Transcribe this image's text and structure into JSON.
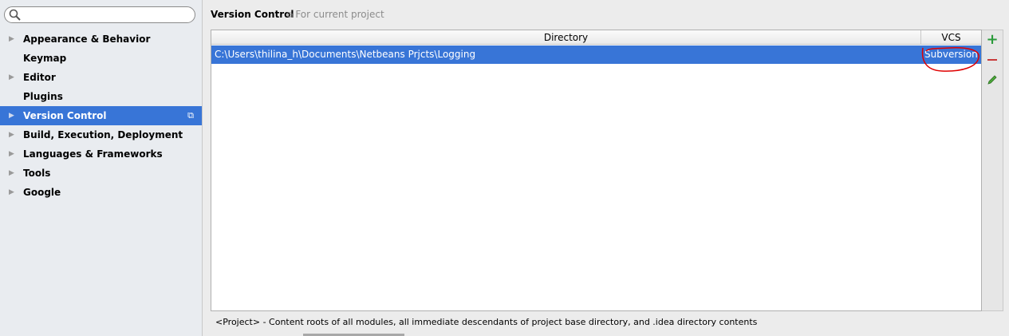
{
  "sidebar": {
    "search_placeholder": "",
    "items": [
      {
        "label": "Appearance & Behavior",
        "expandable": true
      },
      {
        "label": "Keymap",
        "expandable": false
      },
      {
        "label": "Editor",
        "expandable": true
      },
      {
        "label": "Plugins",
        "expandable": false
      },
      {
        "label": "Version Control",
        "expandable": true,
        "selected": true
      },
      {
        "label": "Build, Execution, Deployment",
        "expandable": true
      },
      {
        "label": "Languages & Frameworks",
        "expandable": true
      },
      {
        "label": "Tools",
        "expandable": true
      },
      {
        "label": "Google",
        "expandable": true
      }
    ]
  },
  "header": {
    "title": "Version Control",
    "scope": "For current project"
  },
  "table": {
    "columns": [
      "Directory",
      "VCS"
    ],
    "rows": [
      {
        "directory": "C:\\Users\\thilina_h\\Documents\\Netbeans Prjcts\\Logging",
        "vcs": "Subversion"
      }
    ]
  },
  "footer": "<Project> - Content roots of all modules, all immediate descendants of project base directory, and .idea directory contents",
  "colors": {
    "selection": "#3875d7",
    "annotation": "#e00000",
    "add": "#2a9a3a",
    "remove": "#c83a3a"
  }
}
